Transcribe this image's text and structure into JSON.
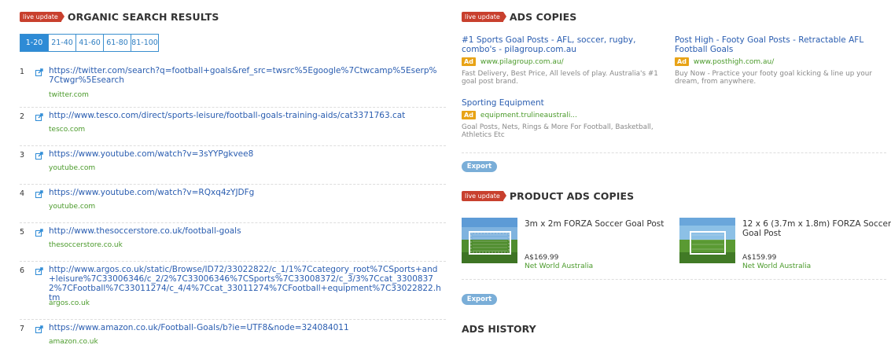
{
  "organic": {
    "badge": "live update",
    "title": "ORGANIC SEARCH RESULTS",
    "pages": [
      "1-20",
      "21-40",
      "41-60",
      "61-80",
      "81-100"
    ],
    "active_page": "1-20",
    "results": [
      {
        "num": "1",
        "url": "https://twitter.com/search?q=football+goals&ref_src=twsrc%5Egoogle%7Ctwcamp%5Eserp%7Ctwgr%5Esearch",
        "domain": "twitter.com"
      },
      {
        "num": "2",
        "url": "http://www.tesco.com/direct/sports-leisure/football-goals-training-aids/cat3371763.cat",
        "domain": "tesco.com"
      },
      {
        "num": "3",
        "url": "https://www.youtube.com/watch?v=3sYYPgkvee8",
        "domain": "youtube.com"
      },
      {
        "num": "4",
        "url": "https://www.youtube.com/watch?v=RQxq4zYJDFg",
        "domain": "youtube.com"
      },
      {
        "num": "5",
        "url": "http://www.thesoccerstore.co.uk/football-goals",
        "domain": "thesoccerstore.co.uk"
      },
      {
        "num": "6",
        "url": "http://www.argos.co.uk/static/Browse/ID72/33022822/c_1/1%7Ccategory_root%7CSports+and+leisure%7C33006346/c_2/2%7C33006346%7CSports%7C33008372/c_3/3%7Ccat_33008372%7CFootball%7C33011274/c_4/4%7Ccat_33011274%7CFootball+equipment%7C33022822.htm",
        "domain": "argos.co.uk"
      },
      {
        "num": "7",
        "url": "https://www.amazon.co.uk/Football-Goals/b?ie=UTF8&node=324084011",
        "domain": "amazon.co.uk"
      }
    ]
  },
  "ads": {
    "badge": "live update",
    "title": "ADS COPIES",
    "ad_tag": "Ad",
    "items": [
      {
        "title": "#1 Sports Goal Posts - AFL, soccer, rugby, combo's - pilagroup.com.au",
        "display_url": "www.pilagroup.com.au/",
        "description": "Fast Delivery, Best Price, All levels of play. Australia's #1 goal post brand."
      },
      {
        "title": "Post High - Footy Goal Posts - Retractable AFL Football Goals",
        "display_url": "www.posthigh.com.au/",
        "description": "Buy Now - Practice your footy goal kicking & line up your dream, from anywhere."
      },
      {
        "title": "Sporting Equipment",
        "display_url": "equipment.trulineaustrali...",
        "description": "Goal Posts, Nets, Rings & More For Football, Basketball, Athletics Etc"
      }
    ],
    "export_label": "Export"
  },
  "product_ads": {
    "badge": "live update",
    "title": "PRODUCT ADS COPIES",
    "items": [
      {
        "title": "3m x 2m FORZA Soccer Goal Post",
        "price": "A$169.99",
        "seller": "Net World Australia"
      },
      {
        "title": "12 x 6 (3.7m x 1.8m) FORZA Soccer Goal Post",
        "price": "A$159.99",
        "seller": "Net World Australia"
      }
    ],
    "export_label": "Export"
  },
  "ads_history": {
    "title": "ADS HISTORY"
  }
}
